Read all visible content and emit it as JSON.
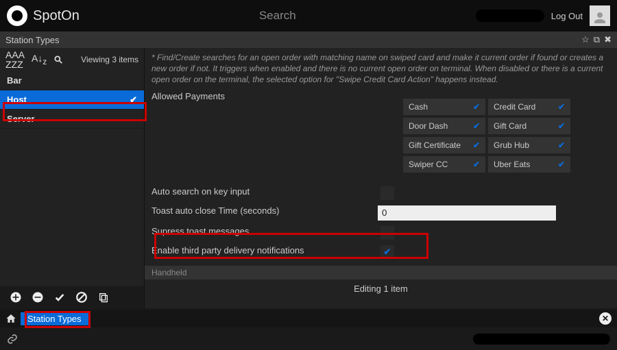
{
  "brand": "SpotOn",
  "search_placeholder": "Search",
  "logout": "Log Out",
  "page_title": "Station Types",
  "viewing": "Viewing 3 items",
  "sidebar": {
    "items": [
      {
        "label": "Bar",
        "selected": false
      },
      {
        "label": "Host",
        "selected": true
      },
      {
        "label": "Server",
        "selected": false
      }
    ]
  },
  "help_text": "* Find/Create searches for an open order with matching name on swiped card and make it current order if found or creates a new order if not. It triggers when enabled and there is no current open order on terminal. When disabled or there is a current open order on the terminal, the selected option for \"Swipe Credit Card Action\" happens instead.",
  "form": {
    "allowed_payments_label": "Allowed Payments",
    "payments": [
      {
        "name": "Cash",
        "on": true
      },
      {
        "name": "Credit Card",
        "on": true
      },
      {
        "name": "Door Dash",
        "on": true
      },
      {
        "name": "Gift Card",
        "on": true
      },
      {
        "name": "Gift Certificate",
        "on": true
      },
      {
        "name": "Grub Hub",
        "on": true
      },
      {
        "name": "Swiper CC",
        "on": true
      },
      {
        "name": "Uber Eats",
        "on": true
      }
    ],
    "auto_search_label": "Auto search on key input",
    "auto_search": false,
    "toast_time_label": "Toast auto close Time (seconds)",
    "toast_time_value": "0",
    "suppress_label": "Supress toast messages",
    "suppress": false,
    "third_party_label": "Enable third party delivery notifications",
    "third_party": true,
    "handheld_label": "Handheld"
  },
  "editing_text": "Editing 1 item",
  "tab_label": "Station Types",
  "icons": {
    "sort_alpha": "AAA/zzz",
    "sort_az": "A↓z",
    "search": "search",
    "add": "plus",
    "remove": "minus",
    "apply": "check",
    "cancel": "slash",
    "copy": "copy",
    "star": "star",
    "window": "window",
    "close": "close",
    "home": "home",
    "link": "link"
  }
}
